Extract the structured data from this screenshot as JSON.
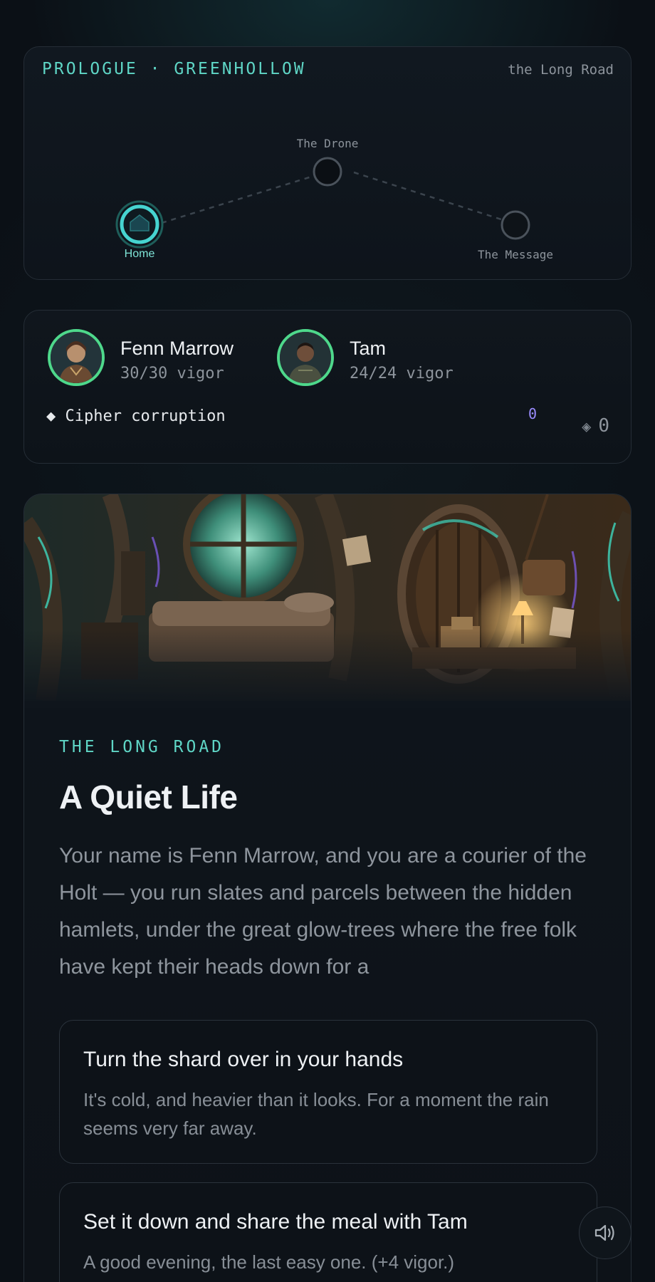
{
  "map": {
    "chapter": "PROLOGUE · GREENHOLLOW",
    "region": "the Long Road",
    "nodes": [
      {
        "label": "Home",
        "state": "current"
      },
      {
        "label": "The Drone",
        "state": "locked"
      },
      {
        "label": "The Message",
        "state": "locked"
      }
    ]
  },
  "party": {
    "members": [
      {
        "name": "Fenn Marrow",
        "vigor": "30/30 vigor",
        "avatar_icon": "portrait-icon"
      },
      {
        "name": "Tam",
        "vigor": "24/24 vigor",
        "avatar_icon": "portrait-icon"
      }
    ],
    "corruption_label": "◆ Cipher corruption",
    "corruption_value": "0",
    "shards": "0"
  },
  "story": {
    "kicker": "THE LONG ROAD",
    "title": "A Quiet Life",
    "body": "Your name is Fenn Marrow, and you are a courier of the Holt — you run slates and parcels between the hidden hamlets, under the great glow-trees where the free folk have kept their heads down for a",
    "choices": [
      {
        "title": "Turn the shard over in your hands",
        "desc": "It's cold, and heavier than it looks. For a moment the rain seems very far away."
      },
      {
        "title": "Set it down and share the meal with Tam",
        "desc": "A good evening, the last easy one. (+4 vigor.)"
      }
    ]
  },
  "colors": {
    "accent": "#5fd6c6",
    "vigor_ring": "#4ed88b",
    "corruption": "#9a8cff",
    "background": "#0b1016"
  },
  "icons": {
    "home_node": "home-icon",
    "sound": "speaker-icon",
    "shard": "shard-icon"
  }
}
